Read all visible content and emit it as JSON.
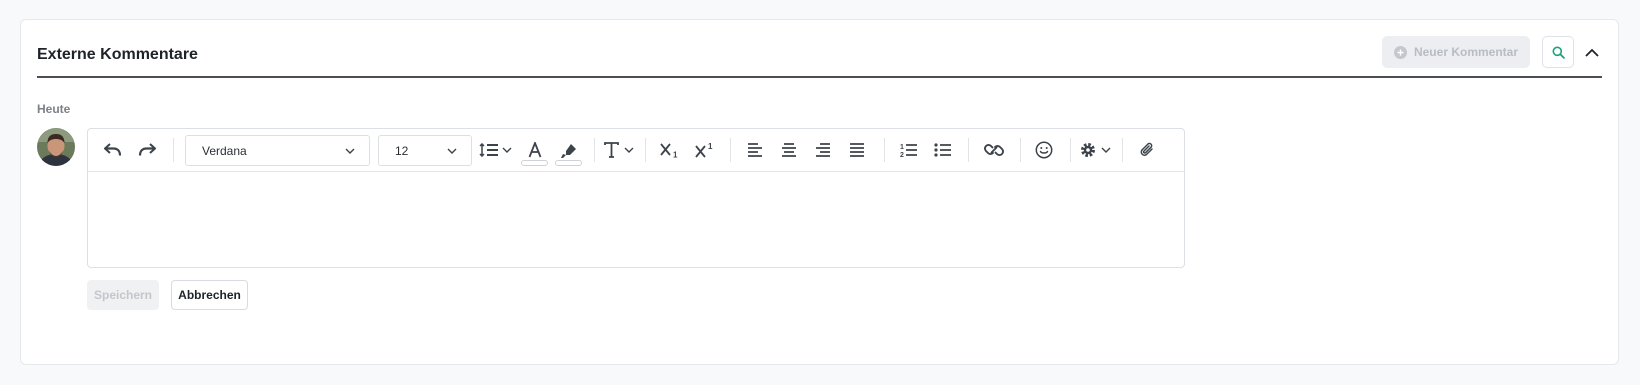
{
  "panel": {
    "title": "Externe Kommentare",
    "new_comment_label": "Neuer Kommentar",
    "search_icon": "search-icon",
    "collapse_icon": "chevron-up-icon"
  },
  "comments": {
    "day_label": "Heute"
  },
  "editor": {
    "font_family": "Verdana",
    "font_size": "12",
    "toolbar_icons": [
      "undo-icon",
      "redo-icon",
      "line-height-icon",
      "font-color-icon",
      "highlight-icon",
      "text-format-icon",
      "subscript-icon",
      "superscript-icon",
      "align-left-icon",
      "align-center-icon",
      "align-right-icon",
      "align-justify-icon",
      "ordered-list-icon",
      "unordered-list-icon",
      "link-icon",
      "emoji-icon",
      "settings-icon",
      "attachment-icon"
    ],
    "content": ""
  },
  "actions": {
    "save_label": "Speichern",
    "cancel_label": "Abbrechen"
  },
  "colors": {
    "accent": "#1aa37a",
    "text": "#1f2329",
    "muted": "#b8bdc4"
  }
}
